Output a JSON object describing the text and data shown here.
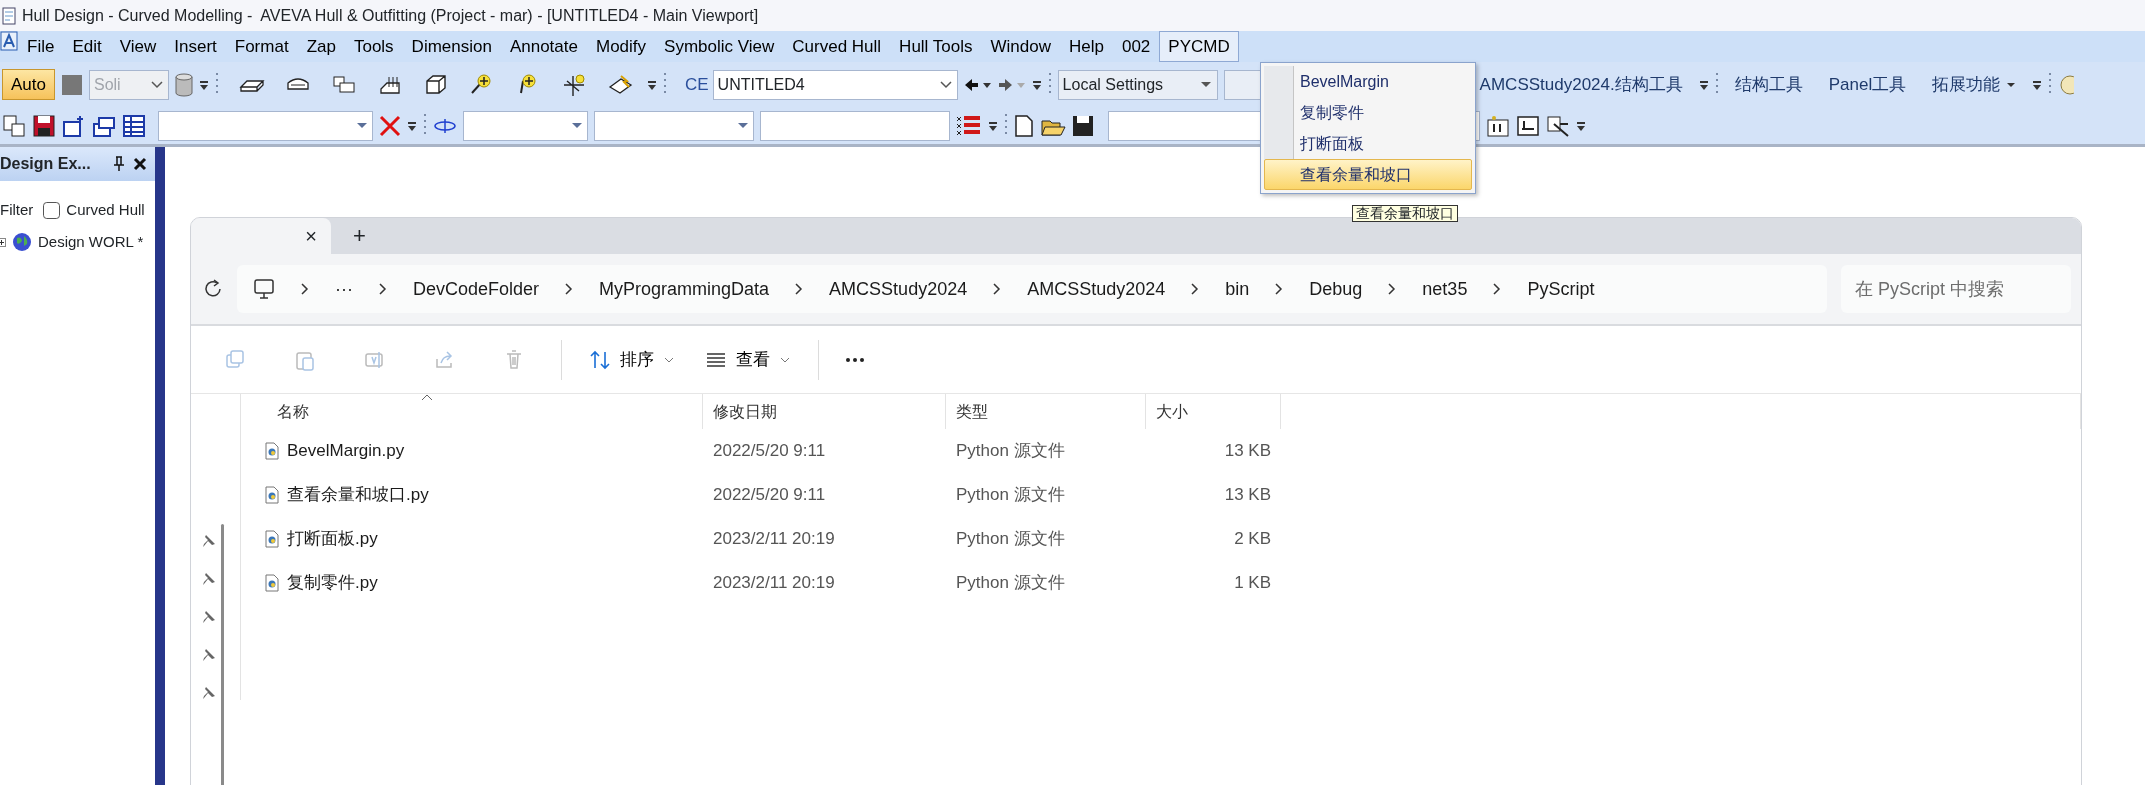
{
  "window": {
    "title": "Hull Design - Curved Modelling -  AVEVA Hull & Outfitting (Project - mar) - [UNTITLED4 - Main Viewport]"
  },
  "menu": [
    {
      "label": "File",
      "selected": false
    },
    {
      "label": "Edit",
      "selected": false
    },
    {
      "label": "View",
      "selected": false
    },
    {
      "label": "Insert",
      "selected": false
    },
    {
      "label": "Format",
      "selected": false
    },
    {
      "label": "Zap",
      "selected": false
    },
    {
      "label": "Tools",
      "selected": false
    },
    {
      "label": "Dimension",
      "selected": false
    },
    {
      "label": "Annotate",
      "selected": false
    },
    {
      "label": "Modify",
      "selected": false
    },
    {
      "label": "Symbolic View",
      "selected": false
    },
    {
      "label": "Curved Hull",
      "selected": false
    },
    {
      "label": "Hull Tools",
      "selected": false
    },
    {
      "label": "Window",
      "selected": false
    },
    {
      "label": "Help",
      "selected": false
    },
    {
      "label": "002",
      "selected": false
    },
    {
      "label": "PYCMD",
      "selected": true
    }
  ],
  "toolbar": {
    "auto_button": "Auto",
    "line_style": "Soli",
    "ce_label": "CE",
    "ce_value": "UNTITLED4",
    "settings": "Local Settings",
    "study_button": "AMCSStudy2024.结构工具",
    "tools": [
      "结构工具",
      "Panel工具",
      "拓展功能"
    ]
  },
  "dropdown_menu": [
    {
      "label": "BevelMargin",
      "selected": false
    },
    {
      "label": "复制零件",
      "selected": false
    },
    {
      "label": "打断面板",
      "selected": false
    },
    {
      "label": "查看余量和坡口",
      "selected": true
    }
  ],
  "tooltip": "查看余量和坡口",
  "design_explorer": {
    "title": "Design Ex...",
    "filter_label": "Filter",
    "curved_hull": {
      "label": "Curved Hull",
      "checked": false
    },
    "tree": [
      {
        "label": "Design WORL *",
        "expanded": false
      }
    ]
  },
  "file_explorer": {
    "close_tab": "×",
    "new_tab": "+",
    "breadcrumbs": [
      "···",
      "DevCodeFolder",
      "MyProgrammingData",
      "AMCSStudy2024",
      "AMCSStudy2024",
      "bin",
      "Debug",
      "net35",
      "PyScript"
    ],
    "search": {
      "placeholder": "在 PyScript 中搜索"
    },
    "commands": [
      "排序",
      "查看"
    ],
    "columns": [
      "名称",
      "修改日期",
      "类型",
      "大小"
    ],
    "rows": [
      {
        "name": "BevelMargin.py",
        "date": "2022/5/20 9:11",
        "type": "Python 源文件",
        "size": "13 KB"
      },
      {
        "name": "查看余量和坡口.py",
        "date": "2022/5/20 9:11",
        "type": "Python 源文件",
        "size": "13 KB"
      },
      {
        "name": "打断面板.py",
        "date": "2023/2/11 20:19",
        "type": "Python 源文件",
        "size": "2 KB"
      },
      {
        "name": "复制零件.py",
        "date": "2023/2/11 20:19",
        "type": "Python 源文件",
        "size": "1 KB"
      }
    ]
  }
}
